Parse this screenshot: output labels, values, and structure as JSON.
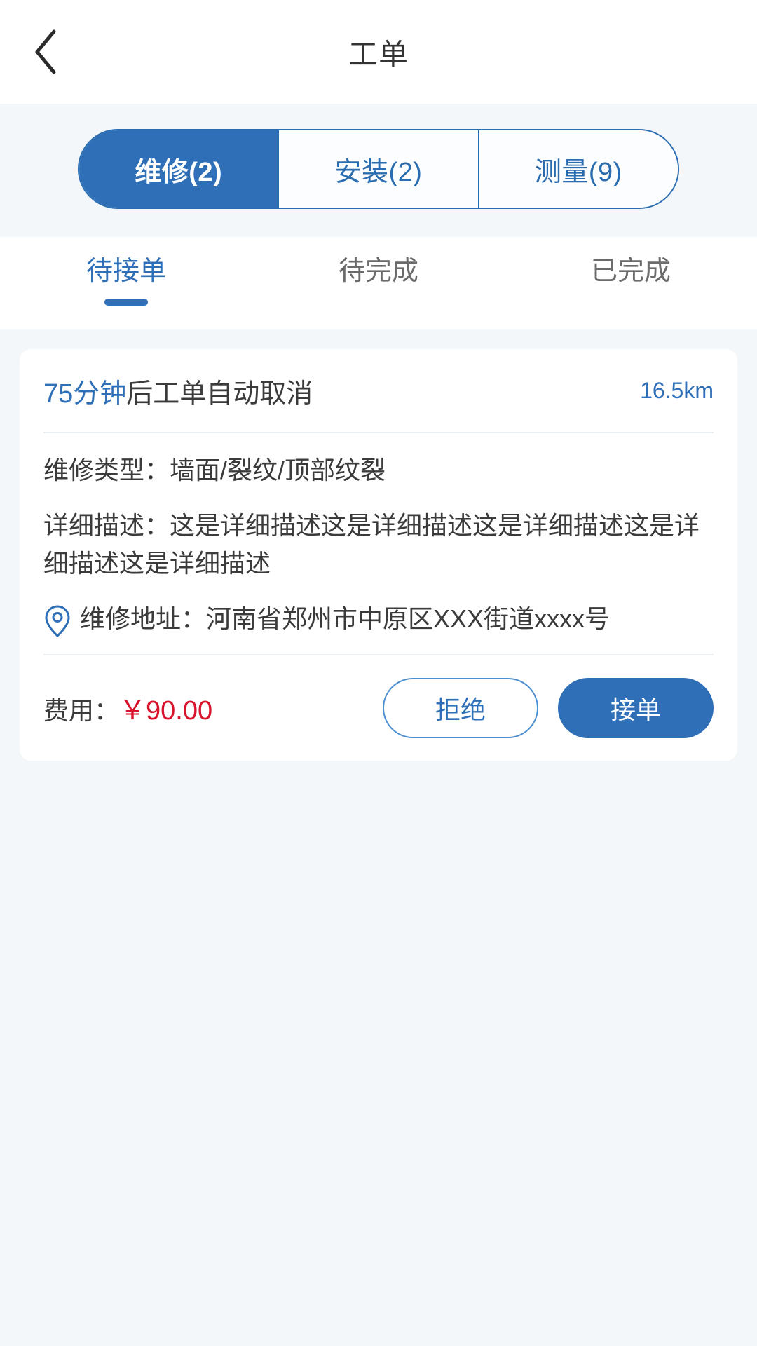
{
  "header": {
    "title": "工单",
    "back_icon": "chevron-left-icon"
  },
  "segmented": {
    "items": [
      {
        "label": "维修(2)",
        "active": true
      },
      {
        "label": "安装(2)",
        "active": false
      },
      {
        "label": "测量(9)",
        "active": false
      }
    ]
  },
  "subtabs": {
    "items": [
      {
        "label": "待接单",
        "active": true
      },
      {
        "label": "待完成",
        "active": false
      },
      {
        "label": "已完成",
        "active": false
      }
    ]
  },
  "card": {
    "timer_value": "75分钟",
    "timer_suffix": "后工单自动取消",
    "distance": "16.5km",
    "repair_type": "维修类型：墙面/裂纹/顶部纹裂",
    "description": "详细描述：这是详细描述这是详细描述这是详细描述这是详细描述这是详细描述",
    "address_icon": "location-pin-icon",
    "address": "维修地址：河南省郑州市中原区XXX街道xxxx号",
    "fee_label": "费用：",
    "fee_amount": "￥90.00",
    "reject_label": "拒绝",
    "accept_label": "接单"
  },
  "colors": {
    "primary": "#2e6fb7",
    "primary_border": "#2a6cb0",
    "page_bg": "#f3f7f9",
    "text": "#3b3b3b",
    "muted": "#6b6b6b",
    "price": "#d8132c"
  }
}
